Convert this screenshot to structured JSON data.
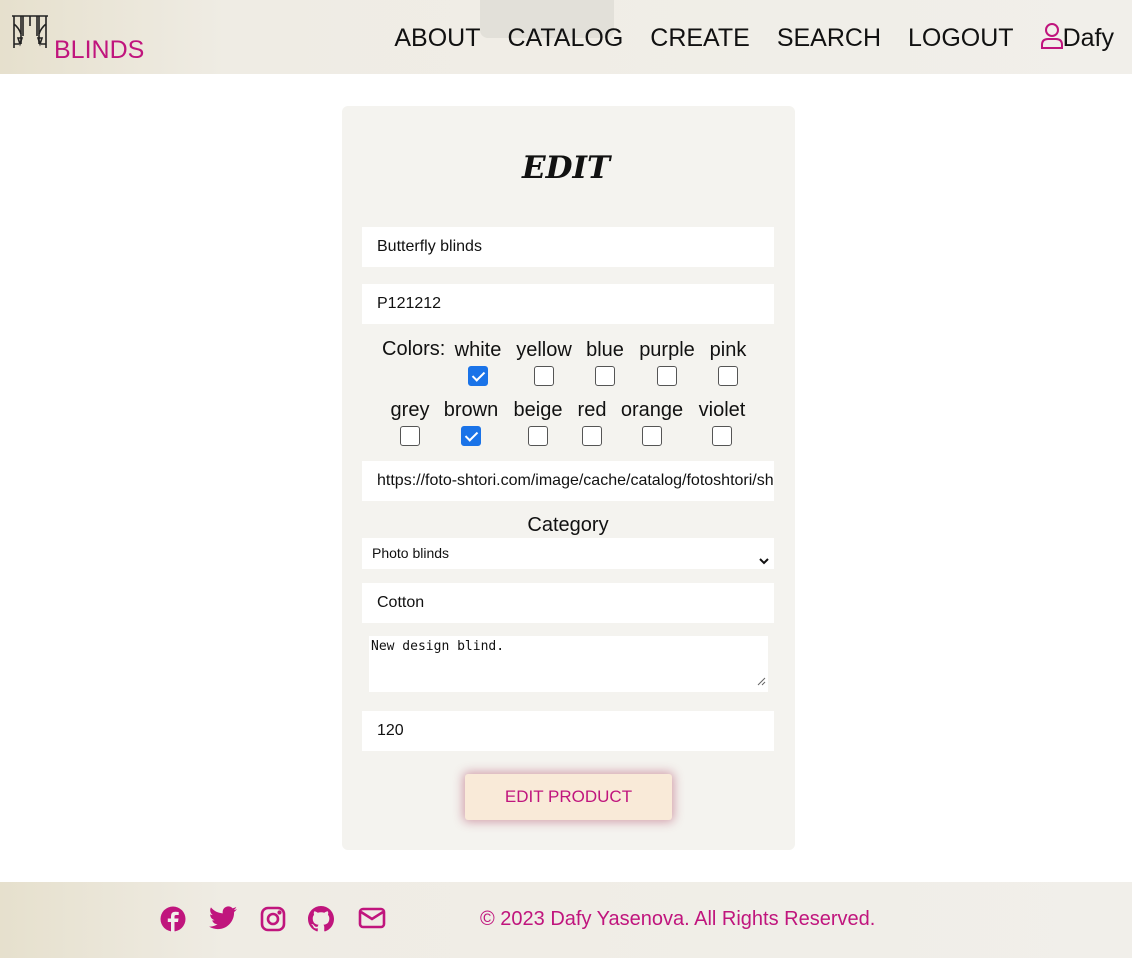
{
  "header": {
    "logo_text": "BLINDS",
    "nav": [
      "ABOUT",
      "CATALOG",
      "CREATE",
      "SEARCH",
      "LOGOUT"
    ],
    "user_name": "Dafy"
  },
  "form": {
    "title": "EDIT",
    "name_value": "Butterfly blinds",
    "code_value": "P121212",
    "colors_label": "Colors:",
    "colors": [
      {
        "name": "white",
        "checked": true
      },
      {
        "name": "yellow",
        "checked": false
      },
      {
        "name": "blue",
        "checked": false
      },
      {
        "name": "purple",
        "checked": false
      },
      {
        "name": "pink",
        "checked": false
      },
      {
        "name": "grey",
        "checked": false
      },
      {
        "name": "brown",
        "checked": true
      },
      {
        "name": "beige",
        "checked": false
      },
      {
        "name": "red",
        "checked": false
      },
      {
        "name": "orange",
        "checked": false
      },
      {
        "name": "violet",
        "checked": false
      }
    ],
    "image_url_value": "https://foto-shtori.com/image/cache/catalog/fotoshtori/sh",
    "category_label": "Category",
    "category_selected": "Photo blinds",
    "material_value": "Cotton",
    "description_value": "New design blind.",
    "price_value": "120",
    "submit_label": "EDIT PRODUCT"
  },
  "footer": {
    "social_icons": [
      "facebook-icon",
      "twitter-icon",
      "instagram-icon",
      "github-icon",
      "envelope-icon"
    ],
    "copyright": "© 2023 Dafy Yasenova. All Rights Reserved."
  },
  "colors": {
    "accent": "#c0157d",
    "checkbox_checked": "#1a73e8",
    "card_bg": "#f4f3ef",
    "button_bg": "#f9ead8"
  }
}
